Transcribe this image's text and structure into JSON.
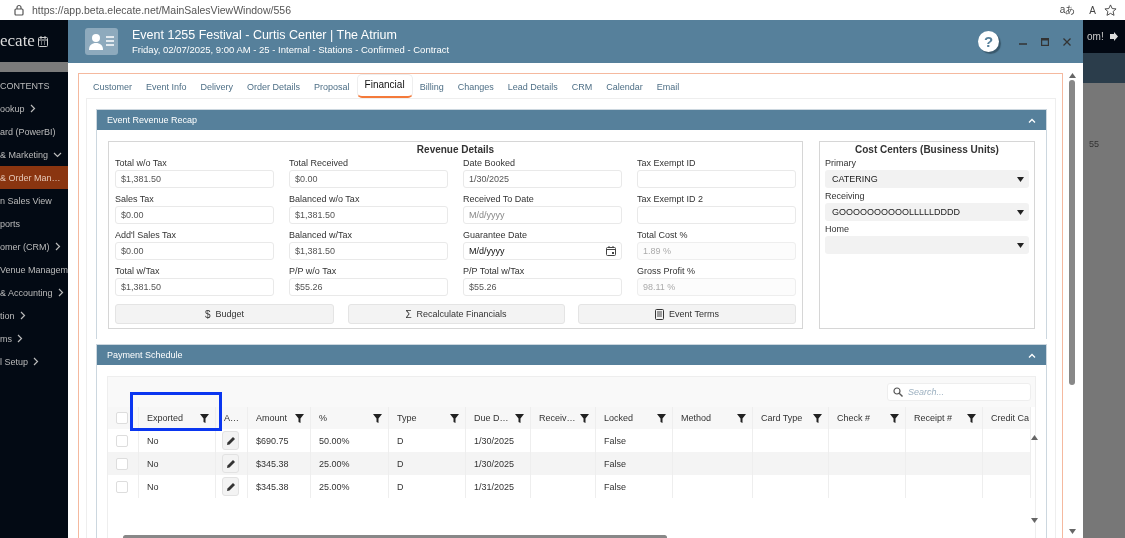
{
  "browser": {
    "url": "https://app.beta.elecate.net/MainSalesViewWindow/556",
    "translate_label": "aあ",
    "read_aloud_label": "A"
  },
  "background_app": {
    "logo": "ecate",
    "sidebar_heading": "CONTENTS",
    "greeting": "om!",
    "row_text": "55",
    "sidebar_items": [
      {
        "label": "ookup",
        "submenu": true,
        "expanded": false,
        "selected": false
      },
      {
        "label": "ard (PowerBI)",
        "submenu": false,
        "selected": false
      },
      {
        "label": "& Marketing",
        "submenu": true,
        "expanded": true,
        "selected": false
      },
      {
        "label": "& Order Man…",
        "submenu": false,
        "selected": true
      },
      {
        "label": "n Sales View",
        "submenu": false,
        "selected": false
      },
      {
        "label": "ports",
        "submenu": false,
        "selected": false
      },
      {
        "label": "omer (CRM)",
        "submenu": true,
        "expanded": false,
        "selected": false
      },
      {
        "label": "Venue Managem",
        "submenu": false,
        "selected": false
      },
      {
        "label": "& Accounting",
        "submenu": true,
        "expanded": false,
        "selected": false
      },
      {
        "label": "tion",
        "submenu": true,
        "expanded": false,
        "selected": false
      },
      {
        "label": "ms",
        "submenu": true,
        "expanded": false,
        "selected": false
      },
      {
        "label": "l Setup",
        "submenu": true,
        "expanded": false,
        "selected": false
      }
    ]
  },
  "window": {
    "title": "Event 1255 Festival - Curtis Center | The Atrium",
    "subtitle": "Friday, 02/07/2025, 9:00 AM - 25 - Internal - Stations - Confirmed - Contract",
    "help": "?"
  },
  "tabs": [
    {
      "label": "Customer",
      "selected": false
    },
    {
      "label": "Event Info",
      "selected": false
    },
    {
      "label": "Delivery",
      "selected": false
    },
    {
      "label": "Order Details",
      "selected": false
    },
    {
      "label": "Proposal",
      "selected": false
    },
    {
      "label": "Financial",
      "selected": true
    },
    {
      "label": "Billing",
      "selected": false
    },
    {
      "label": "Changes",
      "selected": false
    },
    {
      "label": "Lead Details",
      "selected": false
    },
    {
      "label": "CRM",
      "selected": false
    },
    {
      "label": "Calendar",
      "selected": false
    },
    {
      "label": "Email",
      "selected": false
    }
  ],
  "revenue_panel": {
    "title": "Event Revenue Recap",
    "details_title": "Revenue Details",
    "fields": [
      {
        "label": "Total w/o Tax",
        "value": "$1,381.50",
        "disabled": false
      },
      {
        "label": "Total Received",
        "value": "$0.00",
        "disabled": false
      },
      {
        "label": "Date Booked",
        "value": "1/30/2025",
        "disabled": false
      },
      {
        "label": "Tax Exempt ID"
      },
      {
        "label": "Sales Tax",
        "value": "$0.00",
        "disabled": false
      },
      {
        "label": "Balanced w/o Tax",
        "value": "$1,381.50",
        "disabled": false
      },
      {
        "label": "Received To Date",
        "placeholder": "M/d/yyyy"
      },
      {
        "label": "Tax Exempt ID 2"
      },
      {
        "label": "Add'l Sales Tax",
        "value": "$0.00",
        "disabled": false
      },
      {
        "label": "Balanced w/Tax",
        "value": "$1,381.50",
        "disabled": false
      },
      {
        "label": "Guarantee Date",
        "value": "M/d/yyyy",
        "kind": "date"
      },
      {
        "label": "Total Cost %",
        "value": "1.89 %",
        "disabled": true
      },
      {
        "label": "Total w/Tax",
        "value": "$1,381.50",
        "disabled": false
      },
      {
        "label": "P/P w/o Tax",
        "value": "$55.26",
        "disabled": false
      },
      {
        "label": "P/P Total w/Tax",
        "value": "$55.26",
        "disabled": false
      },
      {
        "label": "Gross Profit %",
        "value": "98.11 %",
        "disabled": true
      }
    ],
    "buttons": [
      {
        "kind": "glyph",
        "icon": "$",
        "label": "Budget"
      },
      {
        "kind": "glyph",
        "icon": "Σ",
        "label": "Recalculate Financials"
      },
      {
        "kind": "document",
        "label": "Event Terms"
      }
    ],
    "cost_centers": {
      "title": "Cost Centers (Business Units)",
      "selects": [
        {
          "label": "Primary",
          "value": "CATERING"
        },
        {
          "label": "Receiving",
          "value": "GOOOOOOOOOOLLLLLDDDD"
        },
        {
          "label": "Home"
        }
      ]
    }
  },
  "payment_panel": {
    "title": "Payment Schedule",
    "search": {
      "placeholder": "Search..."
    },
    "columns": [
      {
        "kind": "check",
        "checked": false
      },
      {
        "label": "Exported",
        "filter": true,
        "highlighted": true
      },
      {
        "label": "A…",
        "kind": "edit",
        "filter": false,
        "highlighted": false
      },
      {
        "label": "Amount",
        "filter": true,
        "highlighted": false
      },
      {
        "label": "%",
        "filter": true,
        "highlighted": false
      },
      {
        "label": "Type",
        "filter": true,
        "highlighted": false
      },
      {
        "label": "Due D…",
        "filter": true,
        "highlighted": false
      },
      {
        "label": "Receiv…",
        "filter": true,
        "highlighted": false
      },
      {
        "label": "Locked",
        "filter": true,
        "highlighted": false
      },
      {
        "label": "Method",
        "filter": true,
        "highlighted": false
      },
      {
        "label": "Card Type",
        "filter": true,
        "highlighted": false
      },
      {
        "label": "Check #",
        "filter": true,
        "highlighted": false
      },
      {
        "label": "Receipt #",
        "filter": true,
        "highlighted": false
      },
      {
        "label": "Credit Ca"
      }
    ],
    "rows": [
      {
        "checked": false,
        "cells": [
          "",
          "No",
          "",
          "$690.75",
          "50.00%",
          "D",
          "1/30/2025",
          "",
          "False",
          "",
          "",
          "",
          "",
          ""
        ]
      },
      {
        "checked": false,
        "cells": [
          "",
          "No",
          "",
          "$345.38",
          "25.00%",
          "D",
          "1/30/2025",
          "",
          "False",
          "",
          "",
          "",
          "",
          ""
        ]
      },
      {
        "checked": false,
        "cells": [
          "",
          "No",
          "",
          "$345.38",
          "25.00%",
          "D",
          "1/31/2025",
          "",
          "False",
          "",
          "",
          "",
          "",
          ""
        ]
      }
    ]
  }
}
